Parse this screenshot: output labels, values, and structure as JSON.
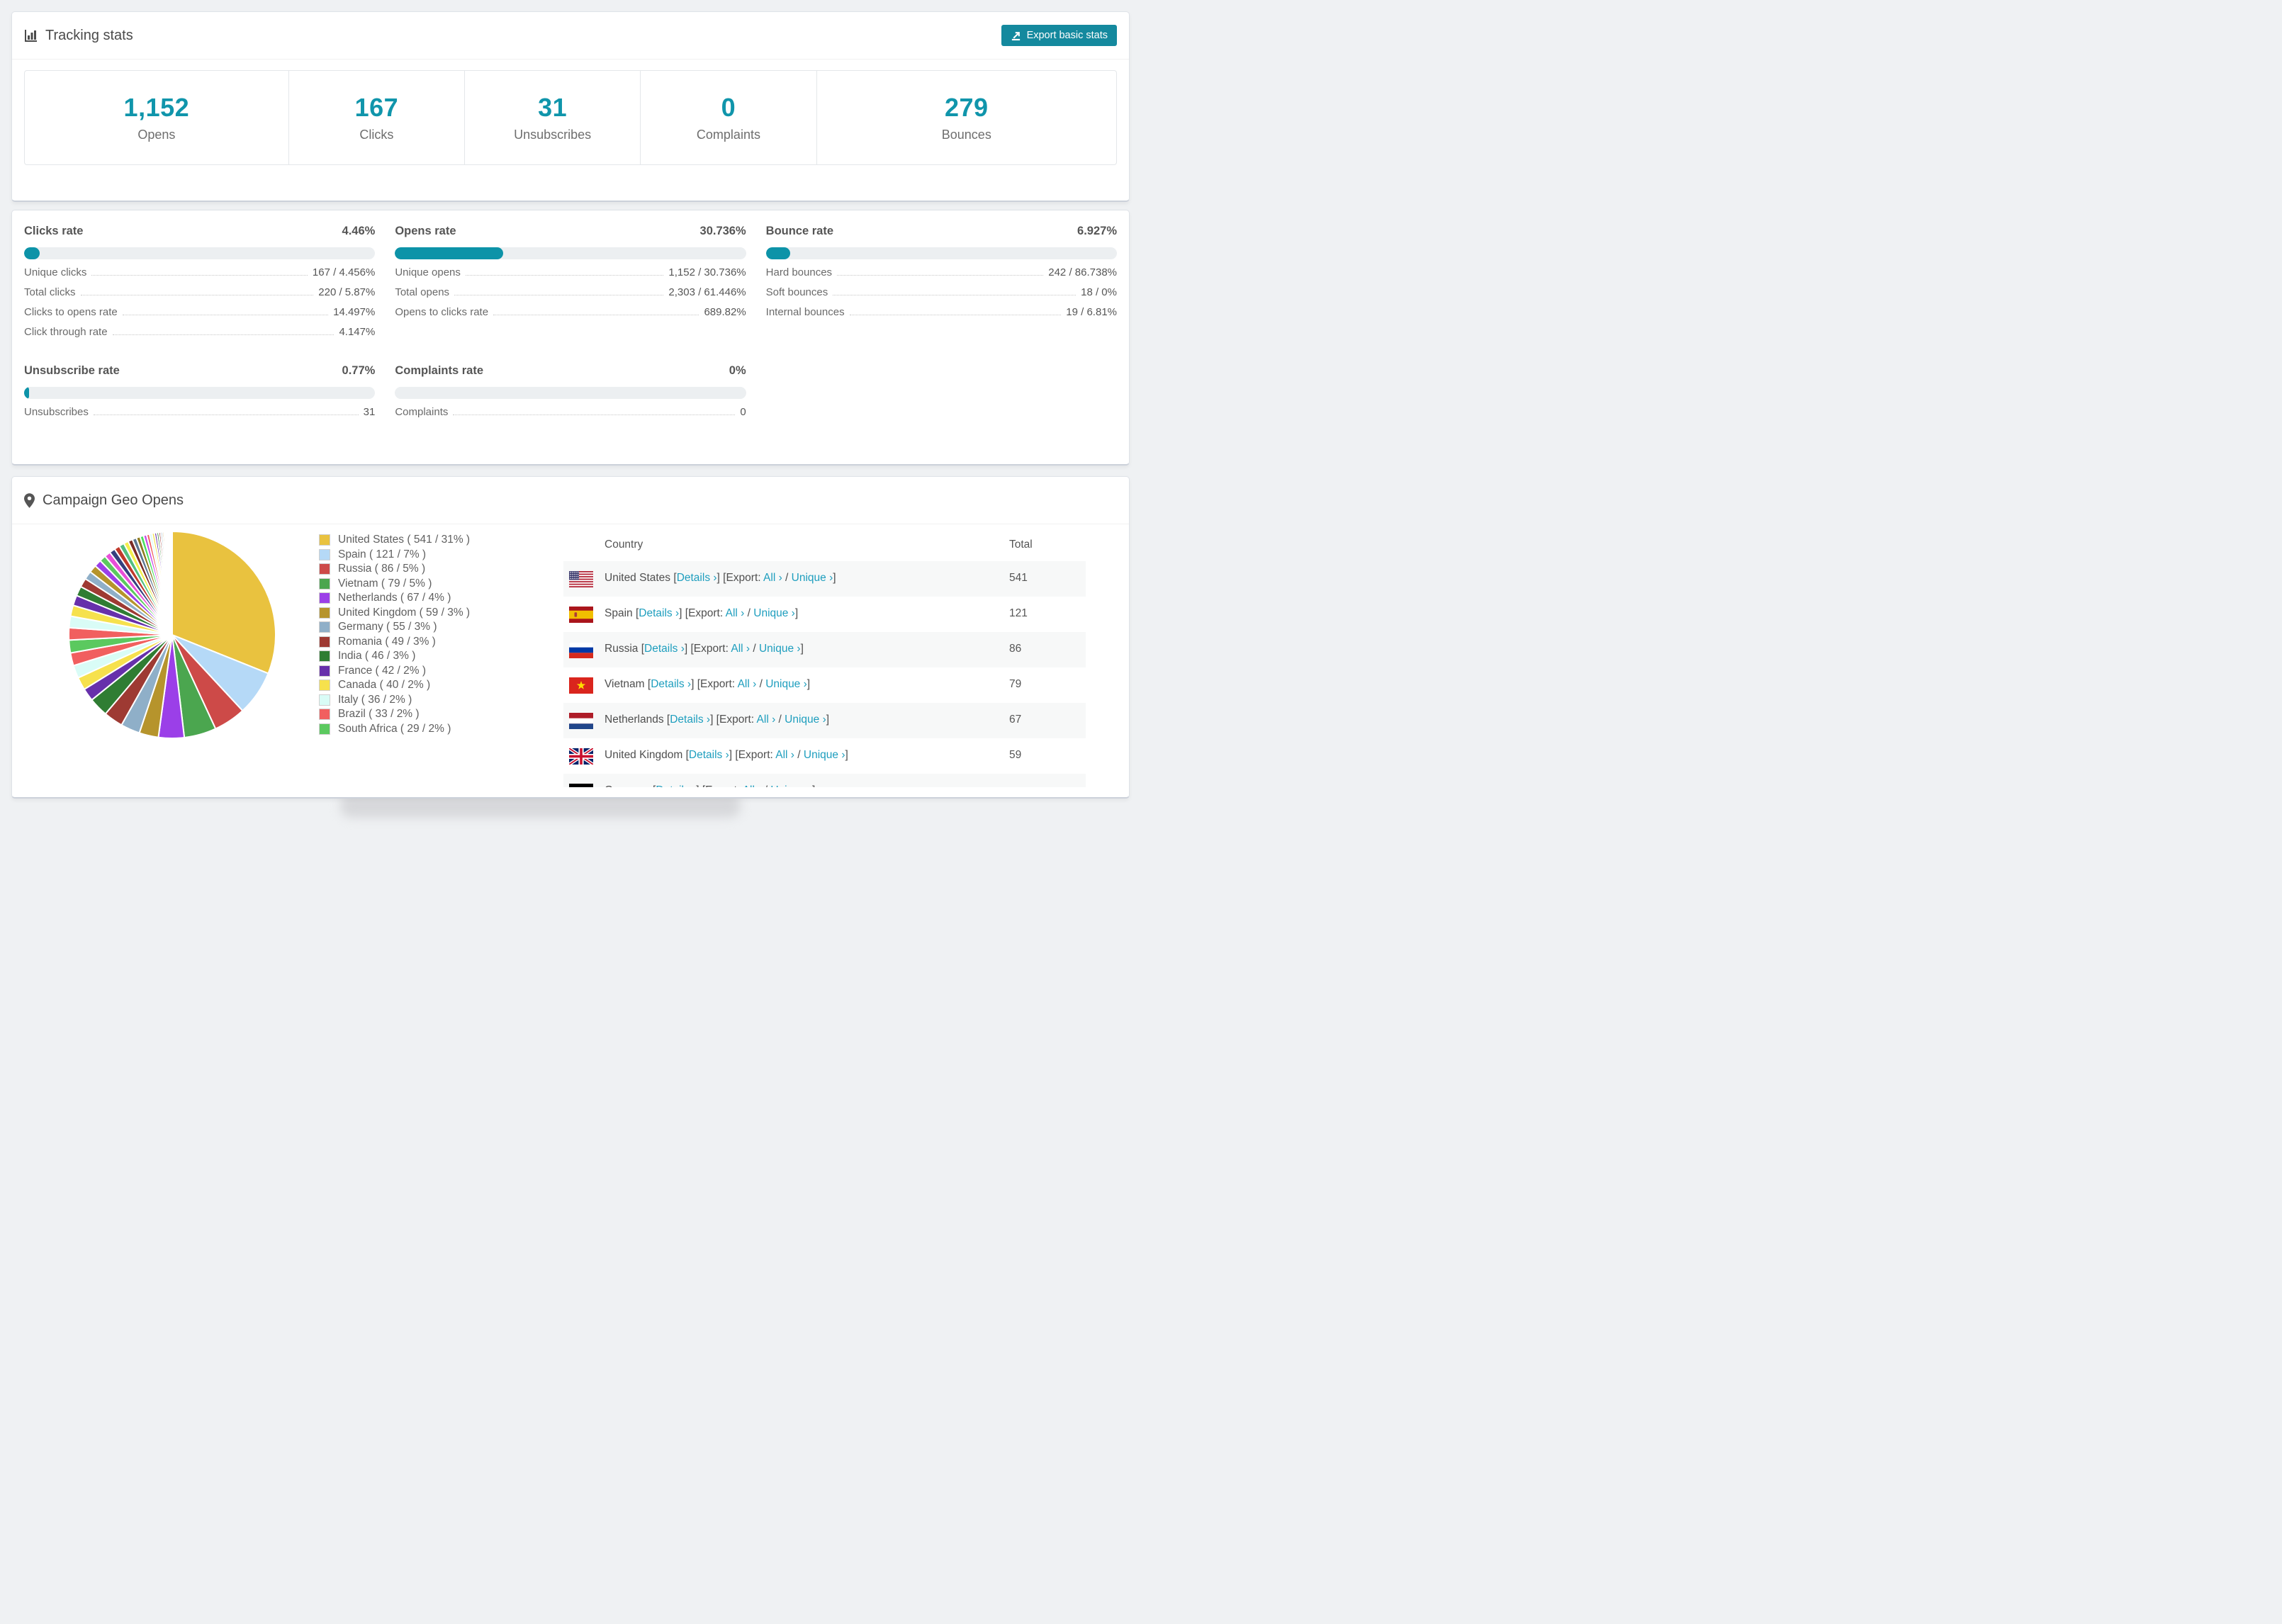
{
  "tracking_card": {
    "title": "Tracking stats",
    "export_button": "Export basic stats",
    "stats": [
      {
        "value": "1,152",
        "label": "Opens"
      },
      {
        "value": "167",
        "label": "Clicks"
      },
      {
        "value": "31",
        "label": "Unsubscribes"
      },
      {
        "value": "0",
        "label": "Complaints"
      },
      {
        "value": "279",
        "label": "Bounces"
      }
    ]
  },
  "rates_card": {
    "panels": [
      {
        "title": "Clicks rate",
        "value": "4.46%",
        "bar_pct": 4.46,
        "rows": [
          [
            "Unique clicks",
            "167 / 4.456%"
          ],
          [
            "Total clicks",
            "220 / 5.87%"
          ],
          [
            "Clicks to opens rate",
            "14.497%"
          ],
          [
            "Click through rate",
            "4.147%"
          ]
        ]
      },
      {
        "title": "Opens rate",
        "value": "30.736%",
        "bar_pct": 30.736,
        "rows": [
          [
            "Unique opens",
            "1,152 / 30.736%"
          ],
          [
            "Total opens",
            "2,303 / 61.446%"
          ],
          [
            "Opens to clicks rate",
            "689.82%"
          ]
        ]
      },
      {
        "title": "Bounce rate",
        "value": "6.927%",
        "bar_pct": 6.927,
        "rows": [
          [
            "Hard bounces",
            "242 / 86.738%"
          ],
          [
            "Soft bounces",
            "18 / 0%"
          ],
          [
            "Internal bounces",
            "19 / 6.81%"
          ]
        ]
      },
      {
        "title": "Unsubscribe rate",
        "value": "0.77%",
        "bar_pct": 0.77,
        "rows": [
          [
            "Unsubscribes",
            "31"
          ]
        ]
      },
      {
        "title": "Complaints rate",
        "value": "0%",
        "bar_pct": 0,
        "rows": [
          [
            "Complaints",
            "0"
          ]
        ]
      }
    ]
  },
  "geo_card": {
    "title": "Campaign Geo Opens",
    "table": {
      "headers": [
        "Country",
        "Total"
      ],
      "details_label": "Details ›",
      "export_label": "Export:",
      "all_label": "All ›",
      "unique_label": "Unique ›",
      "rows": [
        {
          "country": "United States",
          "flag": "us",
          "total": "541"
        },
        {
          "country": "Spain",
          "flag": "es",
          "total": "121"
        },
        {
          "country": "Russia",
          "flag": "ru",
          "total": "86"
        },
        {
          "country": "Vietnam",
          "flag": "vn",
          "total": "79"
        },
        {
          "country": "Netherlands",
          "flag": "nl",
          "total": "67"
        },
        {
          "country": "United Kingdom",
          "flag": "gb",
          "total": "59"
        },
        {
          "country": "Germany",
          "flag": "de",
          "total": ""
        }
      ]
    }
  },
  "chart_data": {
    "type": "pie",
    "title": "Campaign Geo Opens",
    "legend_position": "right",
    "series": [
      {
        "label": "United States",
        "value": 541,
        "pct": 31,
        "color": "#e9c23f"
      },
      {
        "label": "Spain",
        "value": 121,
        "pct": 7,
        "color": "#b5d9f7"
      },
      {
        "label": "Russia",
        "value": 86,
        "pct": 5,
        "color": "#cd4a48"
      },
      {
        "label": "Vietnam",
        "value": 79,
        "pct": 5,
        "color": "#4ba64f"
      },
      {
        "label": "Netherlands",
        "value": 67,
        "pct": 4,
        "color": "#9b3fe8"
      },
      {
        "label": "United Kingdom",
        "value": 59,
        "pct": 3,
        "color": "#b6942c"
      },
      {
        "label": "Germany",
        "value": 55,
        "pct": 3,
        "color": "#8fafc8"
      },
      {
        "label": "Romania",
        "value": 49,
        "pct": 3,
        "color": "#9e3a33"
      },
      {
        "label": "India",
        "value": 46,
        "pct": 3,
        "color": "#2f7d33"
      },
      {
        "label": "France",
        "value": 42,
        "pct": 2,
        "color": "#6730ab"
      },
      {
        "label": "Canada",
        "value": 40,
        "pct": 2,
        "color": "#f6e14d"
      },
      {
        "label": "Italy",
        "value": 36,
        "pct": 2,
        "color": "#d9fcf6"
      },
      {
        "label": "Brazil",
        "value": 33,
        "pct": 2,
        "color": "#f15f5f"
      },
      {
        "label": "South Africa",
        "value": 29,
        "pct": 2,
        "color": "#5bc95f"
      }
    ],
    "legend_format": "{label} ( {value} / {pct}% )",
    "others_estimated_pct": [
      1.9,
      1.8,
      1.7,
      1.6,
      1.5,
      1.4,
      1.3,
      1.2,
      1.1,
      1.0,
      0.95,
      0.9,
      0.85,
      0.8,
      0.75,
      0.7,
      0.65,
      0.6,
      0.55,
      0.5,
      0.45,
      0.4,
      0.38,
      0.35,
      0.32,
      0.3,
      0.28,
      0.25,
      0.22,
      0.2,
      0.18,
      0.15,
      0.12,
      0.1,
      0.08,
      0.06,
      0.05,
      0.04,
      0.03,
      0.02
    ],
    "others_palette": [
      "#f15f5f",
      "#d9fcf6",
      "#f6e14d",
      "#6730ab",
      "#2f7d33",
      "#9e3a33",
      "#8fafc8",
      "#b6942c",
      "#9b3fe8",
      "#5bc95f",
      "#e84fd8",
      "#35407e",
      "#c0392b",
      "#52be80",
      "#f3ef4e",
      "#7a2c26",
      "#5b7590",
      "#8f7b1e",
      "#4adf62",
      "#c94bea"
    ]
  },
  "colors": {
    "accent_teal": "#0d93a8",
    "button_teal": "#14899e",
    "link_teal": "#1e9ebe",
    "stat_number": "#1095ab"
  }
}
